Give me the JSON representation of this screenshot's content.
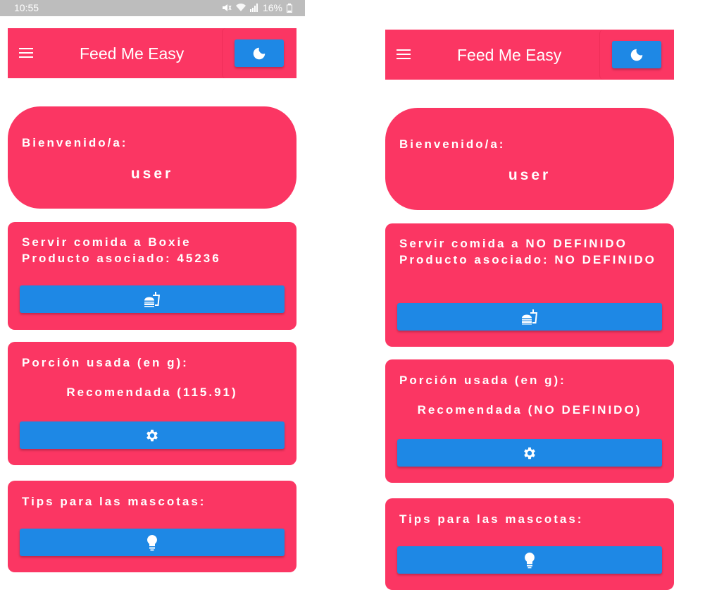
{
  "status_bar": {
    "time": "10:55",
    "battery": "16%"
  },
  "app": {
    "title": "Feed Me Easy"
  },
  "colors": {
    "primary": "#fb3663",
    "button": "#1e88e5",
    "text": "#ffffff"
  },
  "icons": {
    "menu": "hamburger-menu-icon",
    "theme": "moon-icon",
    "feed": "fastfood-icon",
    "settings": "gear-icon",
    "tips": "lightbulb-icon"
  },
  "screens": [
    {
      "welcome_label": "Bienvenido/a:",
      "username": "user",
      "serve_line1": "Servir comida a Boxie",
      "serve_line2": "Producto asociado: 45236",
      "portion_label": "Porción usada (en g):",
      "portion_value": "Recomendada (115.91)",
      "tips_label": "Tips para las mascotas:"
    },
    {
      "welcome_label": "Bienvenido/a:",
      "username": "user",
      "serve_line1": "Servir comida a NO DEFINIDO",
      "serve_line2": "Producto asociado: NO DEFINIDO",
      "portion_label": "Porción usada (en g):",
      "portion_value": "Recomendada (NO DEFINIDO)",
      "tips_label": "Tips para las mascotas:"
    }
  ]
}
